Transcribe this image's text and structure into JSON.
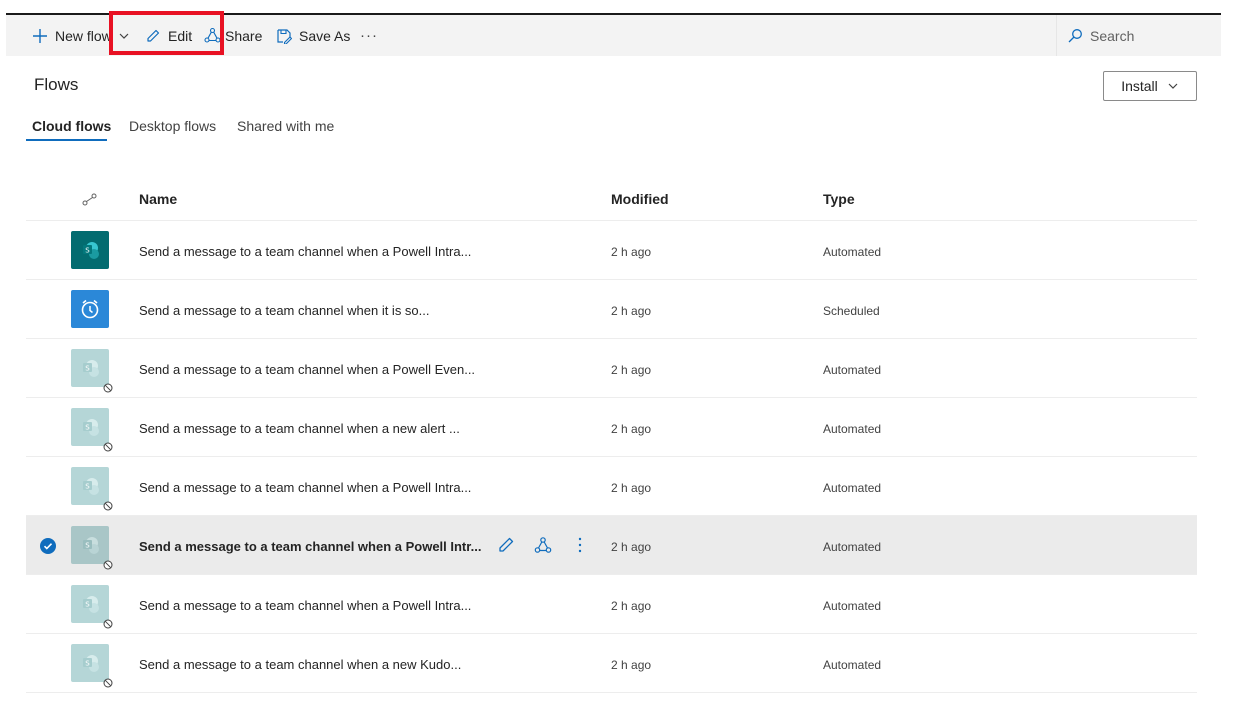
{
  "toolbar": {
    "new_flow": "New flow",
    "edit": "Edit",
    "share": "Share",
    "save_as": "Save As",
    "more": "···",
    "search_placeholder": "Search"
  },
  "page": {
    "title": "Flows",
    "install_label": "Install"
  },
  "tabs": [
    {
      "label": "Cloud flows",
      "active": true
    },
    {
      "label": "Desktop flows",
      "active": false
    },
    {
      "label": "Shared with me",
      "active": false
    }
  ],
  "table": {
    "headers": {
      "name": "Name",
      "modified": "Modified",
      "type": "Type"
    },
    "rows": [
      {
        "name": "Send a message to a team channel when a Powell Intra...",
        "modified": "2 h ago",
        "type": "Automated",
        "icon": "sharepoint-icon",
        "disabled": false
      },
      {
        "name": "Send a message to a team channel when it is so...",
        "modified": "2 h ago",
        "type": "Scheduled",
        "icon": "alarm-clock-icon",
        "disabled": false
      },
      {
        "name": "Send a message to a team channel when a Powell Even...",
        "modified": "2 h ago",
        "type": "Automated",
        "icon": "sharepoint-icon",
        "disabled": true
      },
      {
        "name": "Send a message to a team channel when a new alert ...",
        "modified": "2 h ago",
        "type": "Automated",
        "icon": "sharepoint-icon",
        "disabled": true
      },
      {
        "name": "Send a message to a team channel when a Powell Intra...",
        "modified": "2 h ago",
        "type": "Automated",
        "icon": "sharepoint-icon",
        "disabled": true
      },
      {
        "name": "Send a message to a team channel when a Powell Intr...",
        "modified": "2 h ago",
        "type": "Automated",
        "icon": "sharepoint-icon",
        "disabled": true,
        "selected": true
      },
      {
        "name": "Send a message to a team channel when a Powell Intra...",
        "modified": "2 h ago",
        "type": "Automated",
        "icon": "sharepoint-icon",
        "disabled": true
      },
      {
        "name": "Send a message to a team channel when a new Kudo...",
        "modified": "2 h ago",
        "type": "Automated",
        "icon": "sharepoint-icon",
        "disabled": true
      }
    ]
  },
  "colors": {
    "accent": "#0f6cbd",
    "highlight_box": "#e81123",
    "sharepoint_teal": "#036c70",
    "schedule_blue": "#2b88d8",
    "disabled_icon": "#b5d6d7",
    "selected_row": "#ebebeb"
  }
}
